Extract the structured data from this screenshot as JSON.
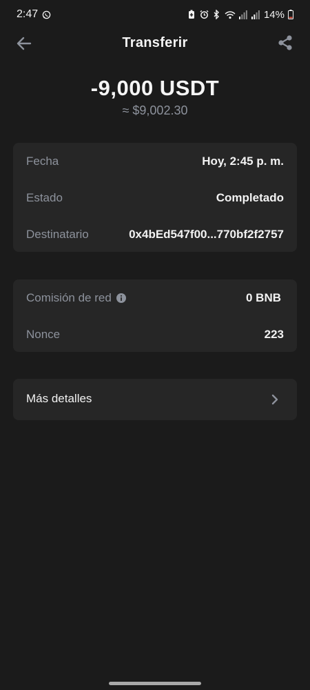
{
  "status_bar": {
    "time": "2:47",
    "battery": "14%"
  },
  "header": {
    "title": "Transferir",
    "back_icon": "arrow-left-icon",
    "share_icon": "share-icon"
  },
  "amount": {
    "value": "-9,000 USDT",
    "fiat": "≈ $9,002.30"
  },
  "details": [
    {
      "label": "Fecha",
      "value": "Hoy, 2:45 p. m."
    },
    {
      "label": "Estado",
      "value": "Completado"
    },
    {
      "label": "Destinatario",
      "value": "0x4bEd547f00...770bf2f2757"
    }
  ],
  "fees": {
    "network_fee": {
      "label": "Comisión de red",
      "value": "0 BNB",
      "icon": "info-icon"
    },
    "nonce": {
      "label": "Nonce",
      "value": "223"
    }
  },
  "more": {
    "label": "Más detalles",
    "icon": "chevron-right-icon"
  },
  "colors": {
    "background": "#1b1b1b",
    "card": "#262626",
    "secondary_text": "#8d929c",
    "primary_text": "#f2f2f2"
  }
}
